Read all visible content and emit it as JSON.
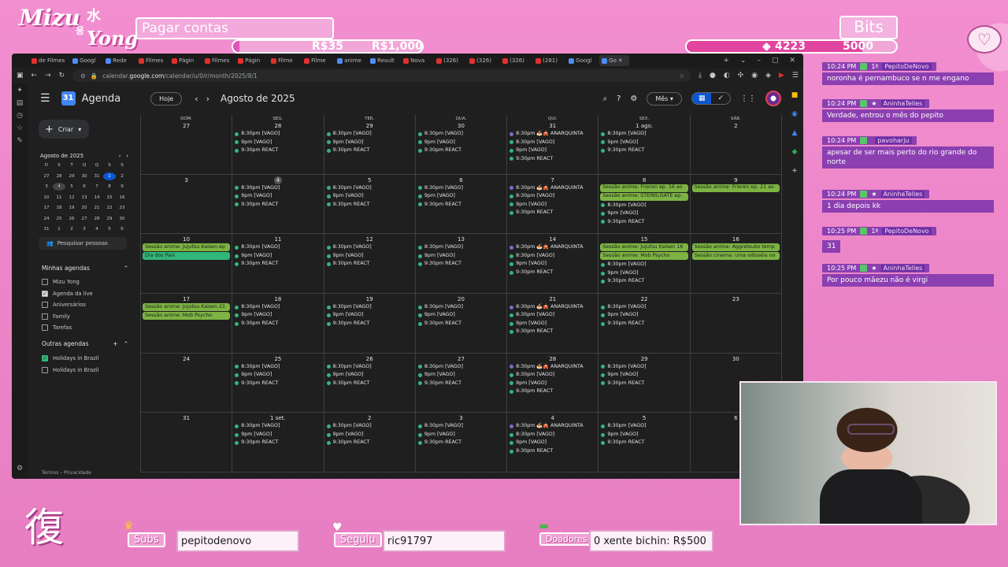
{
  "overlay": {
    "logo_line1": "Mizu",
    "logo_kanji": "水",
    "logo_hangul": "용",
    "logo_line2": "Yong",
    "goal_title": "Pagar contas",
    "goal_current": "R$35",
    "goal_target": "R$1,000",
    "goal_progress": 0.035,
    "bits_title": "Bits",
    "bits_current": "4223",
    "bits_target": "5000",
    "bits_progress": 0.84,
    "corner_kanji": "復",
    "subs_label": "Subs",
    "subs_value": "pepitodenovo",
    "follow_label": "Seguiu",
    "follow_value": "ric91797",
    "donors_label": "Doadores",
    "donors_value": "0 xente bichin: R$500",
    "colors": {
      "pink_bg": "#ed86c8",
      "purple_chat": "#8b3fb0",
      "accent": "#d95fb3"
    }
  },
  "browser": {
    "tabs": [
      "de Filmes",
      "Googl",
      "Rede",
      "Filmes",
      "Págin",
      "Filmes",
      "Págin",
      "Filme",
      "Filme",
      "anime",
      "Result",
      "Nova",
      "(326)",
      "(326)",
      "(326)",
      "(281)",
      "Googl",
      "Go"
    ],
    "url_prefix": "calendar.",
    "url_domain": "google.com",
    "url_path": "/calendar/u/0/r/month/2025/8/1"
  },
  "calendar": {
    "app_name": "Agenda",
    "logo_day": "31",
    "today_label": "Hoje",
    "month_title": "Agosto de 2025",
    "view_label": "Mês",
    "create_label": "Criar",
    "mini_title": "Agosto de 2025",
    "mini_dow": [
      "D",
      "S",
      "T",
      "Q",
      "Q",
      "S",
      "S"
    ],
    "mini_days": [
      "27",
      "28",
      "29",
      "30",
      "31",
      "1",
      "2",
      "3",
      "4",
      "5",
      "6",
      "7",
      "8",
      "9",
      "10",
      "11",
      "12",
      "13",
      "14",
      "15",
      "16",
      "17",
      "18",
      "19",
      "20",
      "21",
      "22",
      "23",
      "24",
      "25",
      "26",
      "27",
      "28",
      "29",
      "30",
      "31",
      "1",
      "2",
      "3",
      "4",
      "5",
      "6"
    ],
    "search_people": "Pesquisar pessoas",
    "my_cals_title": "Minhas agendas",
    "my_cals": [
      {
        "name": "Mizu Yong",
        "checked": false
      },
      {
        "name": "Agenda da live",
        "checked": true
      },
      {
        "name": "Aniversários",
        "checked": false
      },
      {
        "name": "Family",
        "checked": false
      },
      {
        "name": "Tarefas",
        "checked": false
      }
    ],
    "other_cals_title": "Outras agendas",
    "other_cals": [
      {
        "name": "Holidays in Brazil",
        "checked": true
      },
      {
        "name": "Holidays in Brazil",
        "checked": false
      }
    ],
    "footer": "Termos – Privacidade",
    "dow": [
      "DOM.",
      "SEG.",
      "TER.",
      "QUA.",
      "QUI.",
      "SEX.",
      "SÁB."
    ],
    "weeks": [
      [
        {
          "d": "27",
          "ev": []
        },
        {
          "d": "28",
          "ev": [
            "8:30pm [VAGO]",
            "9pm [VAGO]",
            "9:30pm REACT"
          ]
        },
        {
          "d": "29",
          "ev": [
            "8:30pm [VAGO]",
            "9pm [VAGO]",
            "9:30pm REACT"
          ]
        },
        {
          "d": "30",
          "ev": [
            "8:30pm [VAGO]",
            "9pm [VAGO]",
            "9:30pm REACT"
          ]
        },
        {
          "d": "31",
          "ev": [
            "*8:30pm 🍝🎪 ANARQUINTA",
            "8:30pm [VAGO]",
            "9pm [VAGO]",
            "9:30pm REACT"
          ]
        },
        {
          "d": "1 ago.",
          "ev": [
            "8:30pm [VAGO]",
            "9pm [VAGO]",
            "9:30pm REACT"
          ]
        },
        {
          "d": "2",
          "ev": []
        }
      ],
      [
        {
          "d": "3",
          "ev": []
        },
        {
          "d": "4",
          "today": true,
          "ev": [
            "8:30pm [VAGO]",
            "9pm [VAGO]",
            "9:30pm REACT"
          ]
        },
        {
          "d": "5",
          "ev": [
            "8:30pm [VAGO]",
            "9pm [VAGO]",
            "9:30pm REACT"
          ]
        },
        {
          "d": "6",
          "ev": [
            "8:30pm [VAGO]",
            "9pm [VAGO]",
            "9:30pm REACT"
          ]
        },
        {
          "d": "7",
          "ev": [
            "*8:30pm 🍝🎪 ANARQUINTA",
            "8:30pm [VAGO]",
            "9pm [VAGO]",
            "9:30pm REACT"
          ]
        },
        {
          "d": "8",
          "ev": [
            "#Sessão anime: Frieren ep. 16 ao",
            "#Sessão anime: STEINS;GATE ep.",
            "8:30pm [VAGO]",
            "9pm [VAGO]",
            "9:30pm REACT"
          ]
        },
        {
          "d": "9",
          "ev": [
            "#Sessão anime: Frieren ep. 21 ao"
          ]
        }
      ],
      [
        {
          "d": "10",
          "ev": [
            "#Sessão anime: Jujutsu Kaisen ep",
            "$Dia dos Pais"
          ]
        },
        {
          "d": "11",
          "ev": [
            "8:30pm [VAGO]",
            "9pm [VAGO]",
            "9:30pm REACT"
          ]
        },
        {
          "d": "12",
          "ev": [
            "8:30pm [VAGO]",
            "9pm [VAGO]",
            "9:30pm REACT"
          ]
        },
        {
          "d": "13",
          "ev": [
            "8:30pm [VAGO]",
            "9pm [VAGO]",
            "9:30pm REACT"
          ]
        },
        {
          "d": "14",
          "ev": [
            "*8:30pm 🍝🎪 ANARQUINTA",
            "8:30pm [VAGO]",
            "9pm [VAGO]",
            "9:30pm REACT"
          ]
        },
        {
          "d": "15",
          "ev": [
            "#Sessão anime: Jujutsu Kaisen 16",
            "#Sessão anime: Mob Psycho",
            "8:30pm [VAGO]",
            "9pm [VAGO]",
            "9:30pm REACT"
          ]
        },
        {
          "d": "16",
          "ev": [
            "#Sessão anime: Aggretsuko temp",
            "#Sessão cinema: uma odisséia no"
          ]
        }
      ],
      [
        {
          "d": "17",
          "ev": [
            "#Sessão anime: Jujutsu Kaisen 21",
            "#Sessão anime: Mob Psycho"
          ]
        },
        {
          "d": "18",
          "ev": [
            "8:30pm [VAGO]",
            "9pm [VAGO]",
            "9:30pm REACT"
          ]
        },
        {
          "d": "19",
          "ev": [
            "8:30pm [VAGO]",
            "9pm [VAGO]",
            "9:30pm REACT"
          ]
        },
        {
          "d": "20",
          "ev": [
            "8:30pm [VAGO]",
            "9pm [VAGO]",
            "9:30pm REACT"
          ]
        },
        {
          "d": "21",
          "ev": [
            "*8:30pm 🍝🎪 ANARQUINTA",
            "8:30pm [VAGO]",
            "9pm [VAGO]",
            "9:30pm REACT"
          ]
        },
        {
          "d": "22",
          "ev": [
            "8:30pm [VAGO]",
            "9pm [VAGO]",
            "9:30pm REACT"
          ]
        },
        {
          "d": "23",
          "ev": []
        }
      ],
      [
        {
          "d": "24",
          "ev": []
        },
        {
          "d": "25",
          "ev": [
            "8:30pm [VAGO]",
            "9pm [VAGO]",
            "9:30pm REACT"
          ]
        },
        {
          "d": "26",
          "ev": [
            "8:30pm [VAGO]",
            "9pm [VAGO]",
            "9:30pm REACT"
          ]
        },
        {
          "d": "27",
          "ev": [
            "8:30pm [VAGO]",
            "9pm [VAGO]",
            "9:30pm REACT"
          ]
        },
        {
          "d": "28",
          "ev": [
            "*8:30pm 🍝🎪 ANARQUINTA",
            "8:30pm [VAGO]",
            "9pm [VAGO]",
            "9:30pm REACT"
          ]
        },
        {
          "d": "29",
          "ev": [
            "8:30pm [VAGO]",
            "9pm [VAGO]",
            "9:30pm REACT"
          ]
        },
        {
          "d": "30",
          "ev": []
        }
      ],
      [
        {
          "d": "31",
          "ev": []
        },
        {
          "d": "1 set.",
          "ev": [
            "8:30pm [VAGO]",
            "9pm [VAGO]",
            "9:30pm REACT"
          ]
        },
        {
          "d": "2",
          "ev": [
            "8:30pm [VAGO]",
            "9pm [VAGO]",
            "9:30pm REACT"
          ]
        },
        {
          "d": "3",
          "ev": [
            "8:30pm [VAGO]",
            "9pm [VAGO]",
            "9:30pm REACT"
          ]
        },
        {
          "d": "4",
          "ev": [
            "*8:30pm 🍝🎪 ANARQUINTA",
            "8:30pm [VAGO]",
            "9pm [VAGO]",
            "9:30pm REACT"
          ]
        },
        {
          "d": "5",
          "ev": [
            "8:30pm [VAGO]",
            "9pm [VAGO]",
            "9:30pm REACT"
          ]
        },
        {
          "d": "6",
          "ev": []
        }
      ]
    ]
  },
  "chat": [
    {
      "time": "10:24 PM",
      "user": "PepitoDeNovo",
      "text": "noronha é pernambuco se n me engano"
    },
    {
      "time": "10:24 PM",
      "user": "AninhaTelles",
      "text": "Verdade, entrou o mês do pepito"
    },
    {
      "time": "10:24 PM",
      "user": "pavoharju",
      "text": "apesar de ser mais perto do rio grande do norte"
    },
    {
      "time": "10:24 PM",
      "user": "AninhaTelles",
      "text": "1 dia depois kk"
    },
    {
      "time": "10:25 PM",
      "user": "PepitoDeNovo",
      "text": "31"
    },
    {
      "time": "10:25 PM",
      "user": "AninhaTelles",
      "text": "Por pouco mãezu não é virgi"
    }
  ]
}
